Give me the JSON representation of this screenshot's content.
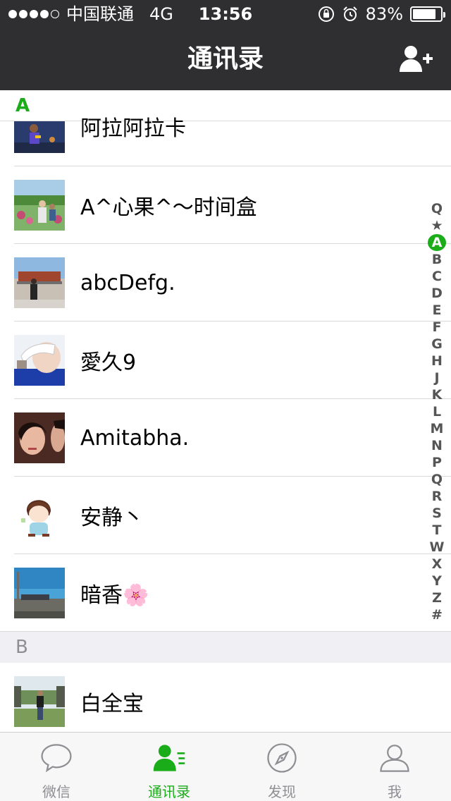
{
  "status_bar": {
    "carrier": "中国联通",
    "network": "4G",
    "time": "13:56",
    "battery": "83%",
    "battery_level": 0.83,
    "signal_bars_filled": 4,
    "signal_bars_total": 5
  },
  "nav": {
    "title": "通讯录",
    "add_icon": "add-contact-icon"
  },
  "sections": [
    {
      "letter": "A",
      "contacts": [
        {
          "name": "阿拉阿拉卡"
        },
        {
          "name": "A^心果^～时间盒"
        },
        {
          "name": "abcDefg."
        },
        {
          "name": "愛久9"
        },
        {
          "name": "Amitabha."
        },
        {
          "name": "安静丶"
        },
        {
          "name": "暗香🌸"
        }
      ]
    },
    {
      "letter": "B",
      "contacts": [
        {
          "name": "白全宝"
        }
      ]
    }
  ],
  "index_bar": {
    "items": [
      "Q",
      "★",
      "A",
      "B",
      "C",
      "D",
      "E",
      "F",
      "G",
      "H",
      "J",
      "K",
      "L",
      "M",
      "N",
      "P",
      "Q",
      "R",
      "S",
      "T",
      "W",
      "X",
      "Y",
      "Z",
      "#"
    ],
    "active": "A"
  },
  "tabs": [
    {
      "label": "微信",
      "icon": "chat-bubble-icon"
    },
    {
      "label": "通讯录",
      "icon": "contacts-icon",
      "active": true
    },
    {
      "label": "发现",
      "icon": "compass-icon"
    },
    {
      "label": "我",
      "icon": "profile-icon"
    }
  ],
  "colors": {
    "accent": "#1aad19",
    "navbar": "#2f2f31",
    "section_gray": "#efeff4"
  }
}
